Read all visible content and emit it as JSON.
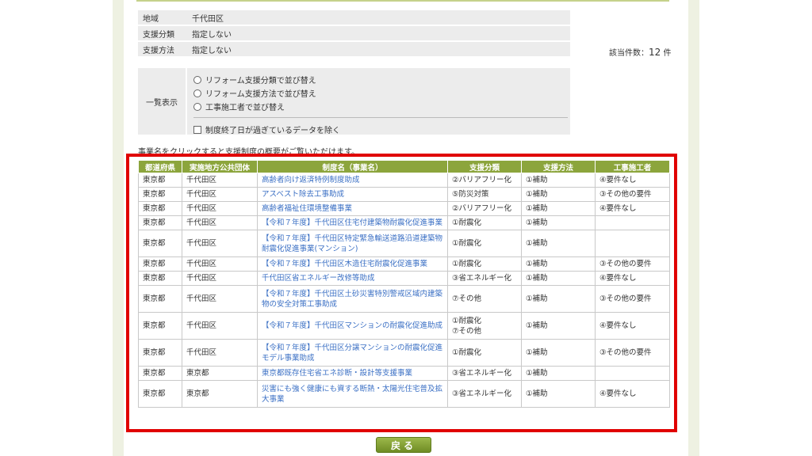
{
  "filters": [
    {
      "label": "地域",
      "value": "千代田区"
    },
    {
      "label": "支援分類",
      "value": "指定しない"
    },
    {
      "label": "支援方法",
      "value": "指定しない"
    }
  ],
  "count": {
    "prefix": "該当件数：",
    "number": "12",
    "suffix": "件"
  },
  "sort": {
    "label": "一覧表示",
    "options": [
      "リフォーム支援分類で並び替え",
      "リフォーム支援方法で並び替え",
      "工事施工者で並び替え"
    ],
    "exclude_expired": "制度終了日が過ぎているデータを除く"
  },
  "note": "事業名をクリックすると支援制度の概要がご覧いただけます。",
  "table": {
    "headers": [
      "都道府県",
      "実施地方公共団体",
      "制度名（事業名）",
      "支援分類",
      "支援方法",
      "工事施工者"
    ],
    "rows": [
      {
        "pref": "東京都",
        "gov": "千代田区",
        "name": "高齢者向け返済特例制度助成",
        "cls": "②バリアフリー化",
        "method": "①補助",
        "builder": "④要件なし"
      },
      {
        "pref": "東京都",
        "gov": "千代田区",
        "name": "アスベスト除去工事助成",
        "cls": "⑤防災対策",
        "method": "①補助",
        "builder": "③その他の要件"
      },
      {
        "pref": "東京都",
        "gov": "千代田区",
        "name": "高齢者福祉住環境整備事業",
        "cls": "②バリアフリー化",
        "method": "①補助",
        "builder": "④要件なし"
      },
      {
        "pref": "東京都",
        "gov": "千代田区",
        "name": "【令和７年度】千代田区住宅付建築物耐震化促進事業",
        "cls": "①耐震化",
        "method": "①補助",
        "builder": ""
      },
      {
        "pref": "東京都",
        "gov": "千代田区",
        "name": "【令和７年度】千代田区特定緊急輸送道路沿道建築物耐震化促進事業(マンション)",
        "cls": "①耐震化",
        "method": "①補助",
        "builder": ""
      },
      {
        "pref": "東京都",
        "gov": "千代田区",
        "name": "【令和７年度】千代田区木造住宅耐震化促進事業",
        "cls": "①耐震化",
        "method": "①補助",
        "builder": "③その他の要件"
      },
      {
        "pref": "東京都",
        "gov": "千代田区",
        "name": "千代田区省エネルギー改修等助成",
        "cls": "③省エネルギー化",
        "method": "①補助",
        "builder": "④要件なし"
      },
      {
        "pref": "東京都",
        "gov": "千代田区",
        "name": "【令和７年度】千代田区土砂災害特別警戒区域内建築物の安全対策工事助成",
        "cls": "⑦その他",
        "method": "①補助",
        "builder": "③その他の要件"
      },
      {
        "pref": "東京都",
        "gov": "千代田区",
        "name": "【令和７年度】千代田区マンションの耐震化促進助成",
        "cls": "①耐震化\n⑦その他",
        "method": "①補助",
        "builder": "④要件なし"
      },
      {
        "pref": "東京都",
        "gov": "千代田区",
        "name": "【令和７年度】千代田区分譲マンションの耐震化促進モデル事業助成",
        "cls": "①耐震化",
        "method": "①補助",
        "builder": "③その他の要件"
      },
      {
        "pref": "東京都",
        "gov": "東京都",
        "name": "東京都既存住宅省エネ診断・設計等支援事業",
        "cls": "③省エネルギー化",
        "method": "①補助",
        "builder": ""
      },
      {
        "pref": "東京都",
        "gov": "東京都",
        "name": "災害にも強く健康にも資する断熱・太陽光住宅普及拡大事業",
        "cls": "③省エネルギー化",
        "method": "①補助",
        "builder": "④要件なし"
      }
    ]
  },
  "back_button": "戻る",
  "colors": {
    "header_green": "#8ca53c",
    "link_blue": "#3a6fc4",
    "highlight_red": "#e00000"
  }
}
